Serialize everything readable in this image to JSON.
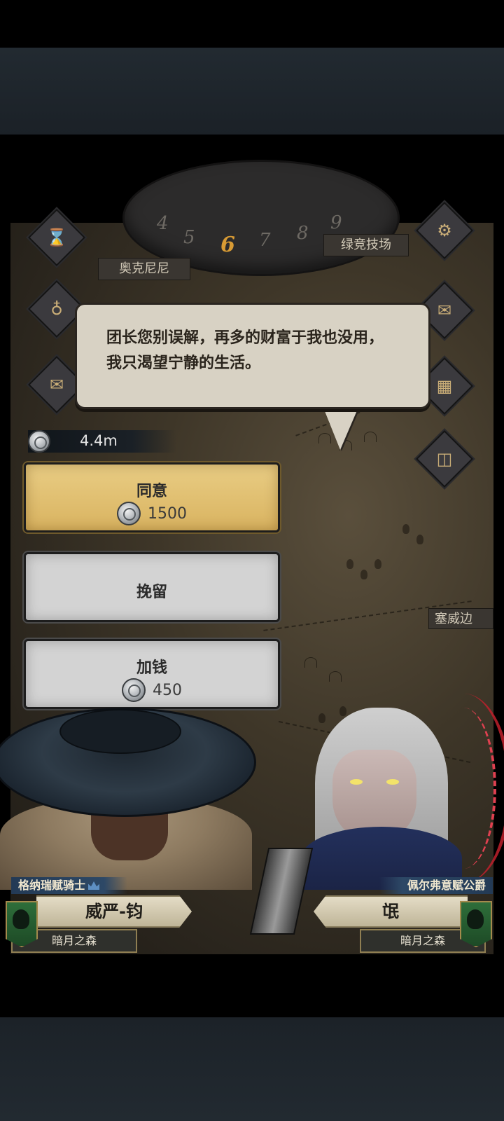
{
  "top_hud": {
    "dial_numbers": [
      "4",
      "5",
      "6",
      "7",
      "8",
      "9"
    ],
    "active_day": "6",
    "location_left": "奥克尼尼",
    "location_right": "绿竞技场",
    "location_side": "塞威边"
  },
  "side_buttons": {
    "hourglass": "hourglass-icon",
    "pouch": "pouch-icon",
    "scroll": "scroll-icon",
    "settings": "gear-icon",
    "mail": "envelope-icon",
    "building": "building-icon",
    "cargo": "cargo-icon"
  },
  "dialogue": {
    "text": "团长您别误解，再多的财富于我也没用，\n我只渴望宁静的生活。"
  },
  "money": {
    "amount": "4.4m"
  },
  "options": [
    {
      "label": "同意",
      "cost": "1500"
    },
    {
      "label": "挽留",
      "cost": null
    },
    {
      "label": "加钱",
      "cost": "450"
    }
  ],
  "characters": {
    "left": {
      "title": "格纳瑞赋骑士",
      "name": "威严-钧",
      "region": "暗月之森"
    },
    "right": {
      "title": "佩尔弗意赋公爵",
      "name": "氓",
      "region": "暗月之森"
    }
  },
  "colors": {
    "accept_button": "#dfc072",
    "neutral_button": "#d3d3d3",
    "banner_green": "#2e6e3a",
    "title_bar_blue": "#2d4866"
  }
}
